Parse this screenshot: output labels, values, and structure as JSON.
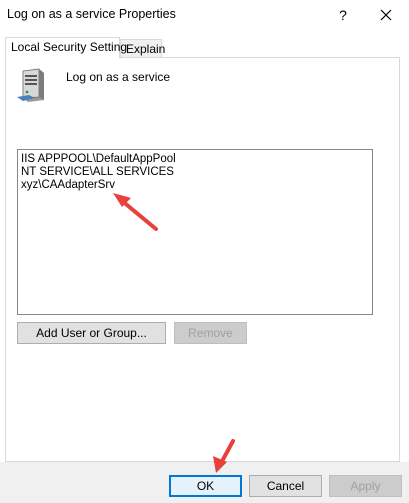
{
  "window": {
    "title": "Log on as a service Properties",
    "help_label": "?"
  },
  "tabs": [
    {
      "label": "Local Security Setting",
      "active": true
    },
    {
      "label": "Explain",
      "active": false
    }
  ],
  "policy": {
    "name": "Log on as a service",
    "icon": "server-icon"
  },
  "accounts": [
    "IIS APPPOOL\\DefaultAppPool",
    "NT SERVICE\\ALL SERVICES",
    "xyz\\CAAdapterSrv"
  ],
  "buttons": {
    "add": "Add User or Group...",
    "remove": "Remove",
    "ok": "OK",
    "cancel": "Cancel",
    "apply": "Apply"
  },
  "colors": {
    "annotation_arrow": "#e8413c",
    "focus_border": "#0078d7"
  }
}
